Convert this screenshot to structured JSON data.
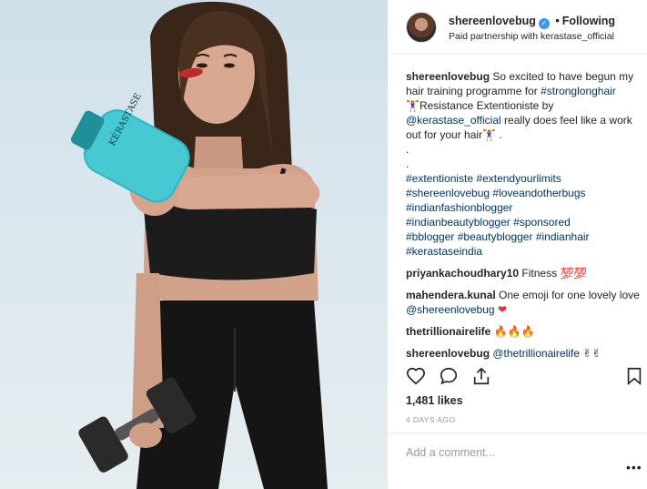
{
  "header": {
    "username": "shereenlovebug",
    "verified_glyph": "✓",
    "separator": "•",
    "follow_status": "Following",
    "partnership": "Paid partnership with kerastase_official"
  },
  "caption": {
    "username": "shereenlovebug",
    "text_1": "So excited to have begun my hair training programme for",
    "hashtag_1": "#stronglonghair",
    "text_2": "🏋‍♀Resistance Extentioniste by",
    "mention_1": "@kerastase_official",
    "text_3": "really does feel like a work out for your hair🏋‍♀ .",
    "dot_1": ".",
    "dot_2": ".",
    "hashtags": [
      "#extentioniste",
      "#extendyourlimits",
      "#shereenlovebug",
      "#loveandotherbugs",
      "#indianfashionblogger",
      "#indianbeautyblogger",
      "#sponsored",
      "#bblogger",
      "#beautyblogger",
      "#indianhair",
      "#kerastaseindia"
    ]
  },
  "comments": [
    {
      "username": "priyankachoudhary10",
      "text": "Fitness",
      "emoji": "💯💯"
    },
    {
      "username": "mahendera.kunal",
      "text": "One emoji for one lovely love",
      "mention": "@shereenlovebug",
      "emoji": "❤"
    },
    {
      "username": "thetrillionairelife",
      "text": "",
      "emoji": "🔥🔥🔥"
    },
    {
      "username": "shereenlovebug",
      "text": "",
      "mention": "@thetrillionairelife",
      "emoji": "✌✌"
    }
  ],
  "stats": {
    "likes": "1,481 likes",
    "time_ago": "4 DAYS AGO"
  },
  "composer": {
    "placeholder": "Add a comment...",
    "more": "•••"
  },
  "icons": {
    "like": "heart-icon",
    "comment": "comment-icon",
    "share": "share-icon",
    "save": "bookmark-icon"
  },
  "product": {
    "brand_text": "KÉRASTASE"
  },
  "colors": {
    "link": "#003569",
    "verified": "#3897f0",
    "muted": "#999999"
  }
}
